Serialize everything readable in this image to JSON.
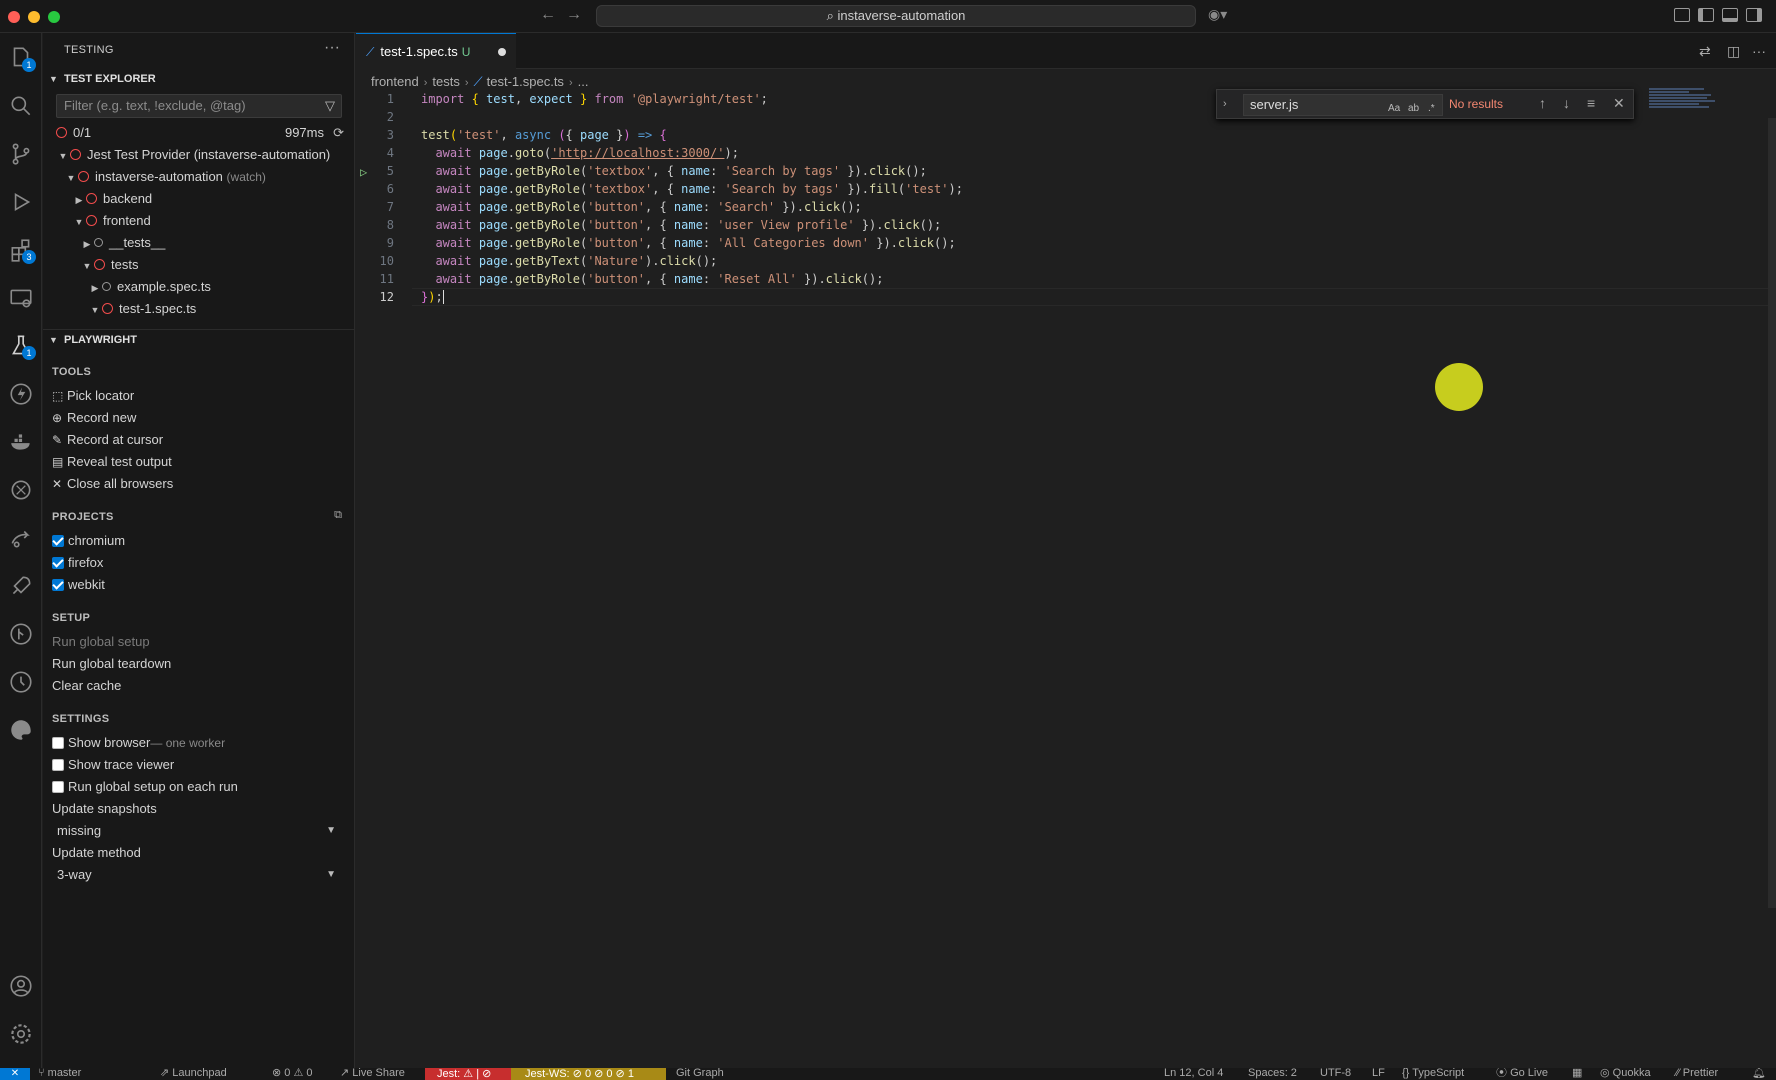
{
  "window": {
    "command_center": "instaverse-automation"
  },
  "activity_bar": {
    "badges": {
      "explorer": "1",
      "extensions": "3",
      "testing": "1"
    }
  },
  "sidebar": {
    "title": "TESTING",
    "test_explorer": {
      "header": "TEST EXPLORER",
      "filter_placeholder": "Filter (e.g. text, !exclude, @tag)",
      "summary_count": "0/1",
      "summary_time": "997ms",
      "tree": [
        {
          "label": "Jest Test Provider (instaverse-automation)"
        },
        {
          "label": "instaverse-automation",
          "note": "(watch)"
        },
        {
          "label": "backend"
        },
        {
          "label": "frontend"
        },
        {
          "label": "__tests__"
        },
        {
          "label": "tests"
        },
        {
          "label": "example.spec.ts"
        },
        {
          "label": "test-1.spec.ts"
        }
      ]
    },
    "playwright": {
      "header": "PLAYWRIGHT",
      "tools_header": "TOOLS",
      "tools": [
        "Pick locator",
        "Record new",
        "Record at cursor",
        "Reveal test output",
        "Close all browsers"
      ],
      "projects_header": "PROJECTS",
      "projects": [
        {
          "label": "chromium",
          "checked": true
        },
        {
          "label": "firefox",
          "checked": true
        },
        {
          "label": "webkit",
          "checked": true
        }
      ],
      "setup_header": "SETUP",
      "setup": [
        "Run global setup",
        "Run global teardown",
        "Clear cache"
      ],
      "settings_header": "SETTINGS",
      "settings": {
        "show_browser": "Show browser",
        "show_browser_note": "— one worker",
        "show_trace_viewer": "Show trace viewer",
        "run_global_setup_each": "Run global setup on each run",
        "update_snapshots_label": "Update snapshots",
        "update_snapshots_value": "missing",
        "update_method_label": "Update method",
        "update_method_value": "3-way"
      }
    }
  },
  "editor": {
    "tab": {
      "name": "test-1.spec.ts",
      "status": "U"
    },
    "breadcrumb": [
      "frontend",
      "tests",
      "test-1.spec.ts",
      "..."
    ],
    "line_numbers": [
      "1",
      "2",
      "3",
      "4",
      "5",
      "6",
      "7",
      "8",
      "9",
      "10",
      "11",
      "12"
    ],
    "find_widget": {
      "query": "server.js",
      "result": "No results",
      "opt_case": "Aa",
      "opt_word": "ab",
      "opt_regex": ".*"
    }
  },
  "status_bar": {
    "branch": "master",
    "launchpad": "Launchpad",
    "problems": "0 ⚠ 0",
    "live_share": "Live Share",
    "jest": "Jest: ⚠ | ⊘",
    "jest_ws": "Jest-WS: ⊘ 0 ⊘ 0 ⊘ 1",
    "git_graph": "Git Graph",
    "position": "Ln 12, Col 4",
    "spaces": "Spaces: 2",
    "encoding": "UTF-8",
    "eol": "LF",
    "language": "TypeScript",
    "go_live": "Go Live",
    "quokka": "Quokka",
    "prettier": "Prettier"
  }
}
